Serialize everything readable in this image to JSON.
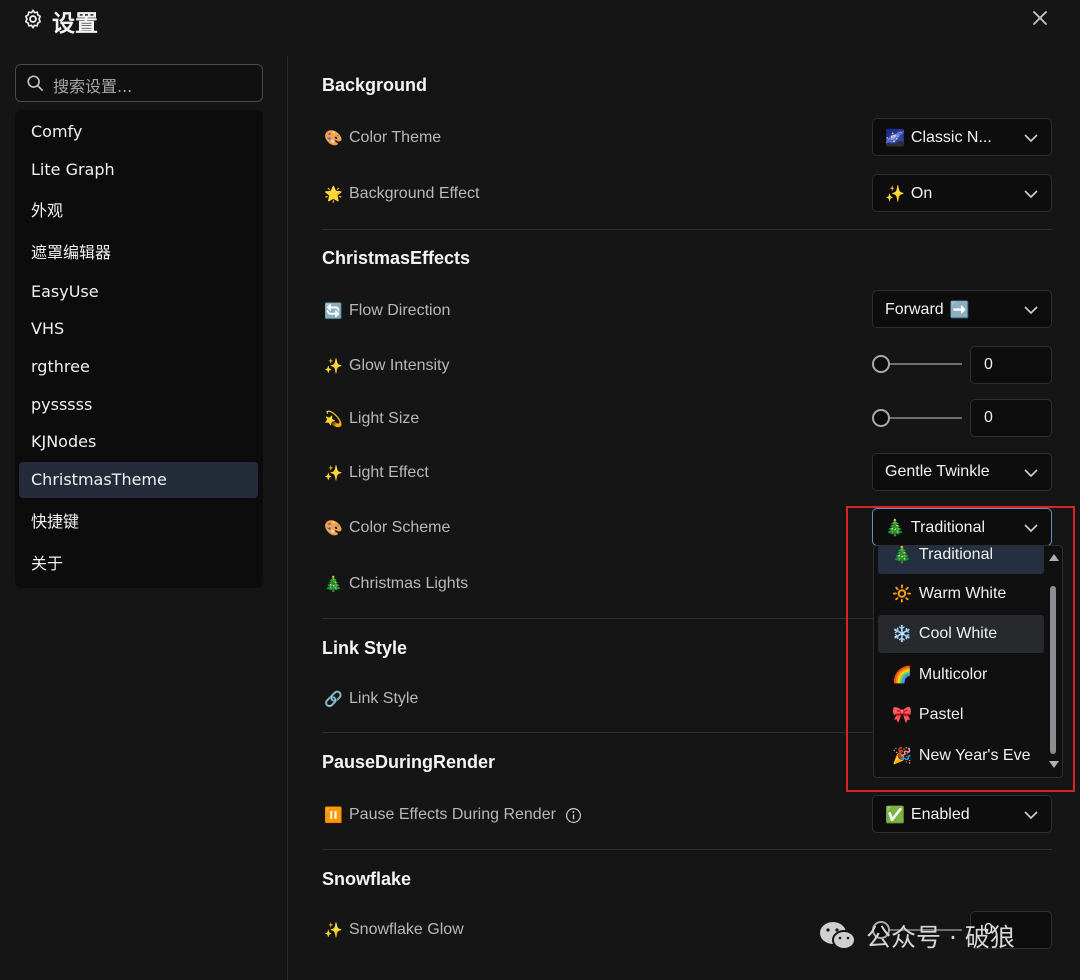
{
  "header": {
    "title": "设置",
    "icon": "gear-icon",
    "close_icon": "close-icon"
  },
  "search": {
    "placeholder": "搜索设置..."
  },
  "sidebar": {
    "items": [
      {
        "label": "Comfy"
      },
      {
        "label": "Lite Graph"
      },
      {
        "label": "外观"
      },
      {
        "label": "遮罩编辑器"
      },
      {
        "label": "EasyUse"
      },
      {
        "label": "VHS"
      },
      {
        "label": "rgthree"
      },
      {
        "label": "pysssss"
      },
      {
        "label": "KJNodes"
      },
      {
        "label": "ChristmasTheme",
        "active": true
      },
      {
        "label": "快捷键"
      },
      {
        "label": "关于"
      }
    ]
  },
  "sections": {
    "background": {
      "title": "Background",
      "color_theme": {
        "emoji": "🎨",
        "label": "Color Theme",
        "value_emoji": "🌌",
        "value": "Classic N..."
      },
      "background_effect": {
        "emoji": "🌟",
        "label": "Background Effect",
        "value_emoji": "✨",
        "value": "On"
      }
    },
    "christmas": {
      "title": "ChristmasEffects",
      "flow_direction": {
        "emoji": "🔄",
        "label": "Flow Direction",
        "value": "Forward",
        "value_emoji": "➡️"
      },
      "glow_intensity": {
        "emoji": "✨",
        "label": "Glow Intensity",
        "value": "0"
      },
      "light_size": {
        "emoji": "💫",
        "label": "Light Size",
        "value": "0"
      },
      "light_effect": {
        "emoji": "✨",
        "label": "Light Effect",
        "value": "Gentle Twinkle"
      },
      "color_scheme": {
        "emoji": "🎨",
        "label": "Color Scheme",
        "value_emoji": "🎄",
        "value": "Traditional"
      },
      "christmas_lights": {
        "emoji": "🎄",
        "label": "Christmas Lights"
      }
    },
    "link": {
      "title": "Link Style",
      "link_style": {
        "emoji": "🔗",
        "label": "Link Style"
      }
    },
    "pause": {
      "title": "PauseDuringRender",
      "pause_effects": {
        "emoji": "⏸️",
        "label": "Pause Effects During Render",
        "info_icon": "info-icon",
        "value_emoji": "✅",
        "value": "Enabled"
      }
    },
    "snowflake": {
      "title": "Snowflake",
      "snowflake_glow": {
        "emoji": "✨",
        "label": "Snowflake Glow",
        "value": "0"
      }
    }
  },
  "dropdown": {
    "options": [
      {
        "emoji": "🎄",
        "label": "Traditional",
        "selected": true
      },
      {
        "emoji": "🔆",
        "label": "Warm White"
      },
      {
        "emoji": "❄️",
        "label": "Cool White",
        "highlighted": true
      },
      {
        "emoji": "🌈",
        "label": "Multicolor"
      },
      {
        "emoji": "🎀",
        "label": "Pastel"
      },
      {
        "emoji": "🎉",
        "label": "New Year's Eve"
      }
    ]
  },
  "slider_levels": {
    "glow_intensity": 0,
    "light_size": 0
  },
  "watermark": {
    "text": "公众号 · 破狼",
    "icon": "wechat-icon"
  },
  "colors": {
    "highlight_box": "#d6242a",
    "active_nav": "#232c38",
    "background": "#151516"
  }
}
